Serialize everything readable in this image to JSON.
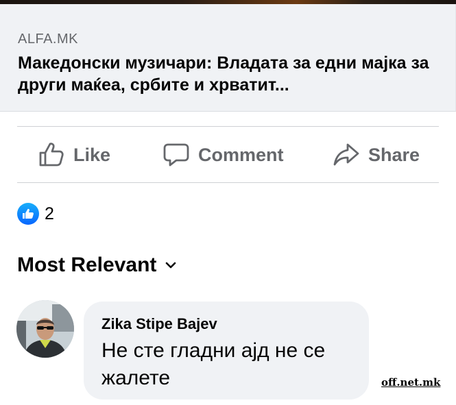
{
  "link_preview": {
    "domain": "ALFA.MK",
    "title": "Македонски музичари: Владата за едни мајка за други маќеа, србите и хрватит..."
  },
  "actions": {
    "like_label": "Like",
    "comment_label": "Comment",
    "share_label": "Share"
  },
  "reactions": {
    "count": "2",
    "icon": "thumbs-up-icon",
    "color": "#1877f2"
  },
  "comments_section": {
    "sort_label": "Most Relevant",
    "sort_icon": "chevron-down-icon"
  },
  "comment": {
    "author": "Zika Stipe Bajev",
    "text": "Не сте гладни ајд не се жалете"
  },
  "watermark": "off.net.mk",
  "colors": {
    "secondary_text": "#65676b",
    "primary_text": "#050505",
    "bubble_bg": "#f0f2f5",
    "brand_blue": "#0866ff"
  }
}
